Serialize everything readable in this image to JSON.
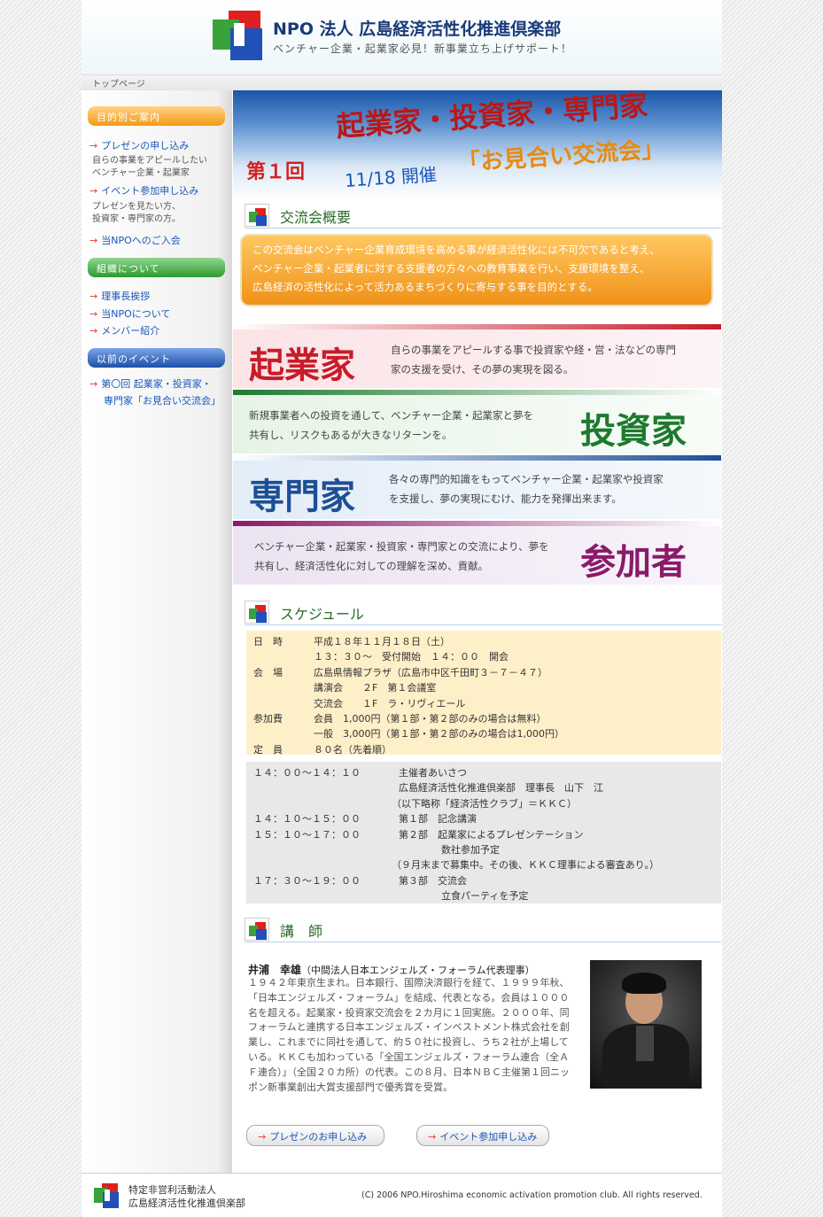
{
  "header": {
    "title": "NPO 法人 広島経済活性化推進倶楽部",
    "subtitle": "ベンチャー企業・起業家必見！新事業立ち上げサポート！"
  },
  "breadcrumb": "トップページ",
  "sidebar": {
    "section1": "目的別ご案内",
    "link_presentation": "プレゼンの申し込み",
    "desc_presentation_1": "自らの事業をアピールしたい",
    "desc_presentation_2": "ベンチャー企業・起業家",
    "link_event": "イベント参加申し込み",
    "desc_event_1": "プレゼンを見たい方、",
    "desc_event_2": "投資家・専門家の方。",
    "link_join": "当NPOへのご入会",
    "section2": "組織について",
    "link_greeting": "理事長挨拶",
    "link_about": "当NPOについて",
    "link_members": "メンバー紹介",
    "section3": "以前のイベント",
    "link_past_1": "第〇回 起業家・投資家・",
    "link_past_2": "専門家「お見合い交流会」"
  },
  "hero": {
    "number": "第１回",
    "title": "起業家・投資家・専門家",
    "date": "11/18 開催",
    "subtitle": "「お見合い交流会」"
  },
  "overview": {
    "heading": "交流会概要",
    "line1": "この交流会はベンチャー企業育成環境を高める事が経済活性化には不可欠であると考え、",
    "line2": "ベンチャー企業・起業者に対する支援者の方々への教育事業を行い、支援環境を整え、",
    "line3": "広島経済の活性化によって活力あるまちづくりに寄与する事を目的とする。"
  },
  "roles": {
    "entrepreneur": {
      "name": "起業家",
      "line1": "自らの事業をアピールする事で投資家や経・営・法などの専門",
      "line2": "家の支援を受け、その夢の実現を図る。",
      "color": "#c81c2a"
    },
    "investor": {
      "name": "投資家",
      "line1": "新規事業者への投資を通して、ベンチャー企業・起業家と夢を",
      "line2": "共有し、リスクもあるが大きなリターンを。",
      "color": "#1d7a2e"
    },
    "expert": {
      "name": "専門家",
      "line1": "各々の専門的知識をもってベンチャー企業・起業家や投資家",
      "line2": "を支援し、夢の実現にむけ、能力を発揮出来ます。",
      "color": "#1d4f96"
    },
    "participant": {
      "name": "参加者",
      "line1": "ベンチャー企業・起業家・投資家・専門家との交流により、夢を",
      "line2": "共有し、経済活性化に対しての理解を深め、貢献。",
      "color": "#8a1a6a"
    }
  },
  "schedule": {
    "heading": "スケジュール",
    "date_label": "日　時",
    "date_value": "平成１８年１１月１８日（土）",
    "time_value": "１３：３０～　受付開始　１４：００　開会",
    "venue_label": "会　場",
    "venue_value": "広島県情報プラザ（広島市中区千田町３－７－４７）",
    "venue_hall": "講演会　　２F　第１会議室",
    "venue_party": "交流会　　１F　ラ・リヴィエール",
    "fee_label": "参加費",
    "fee_member": "会員　1,000円（第１部・第２部のみの場合は無料）",
    "fee_general": "一般　3,000円（第１部・第２部のみの場合は1,000円）",
    "capacity_label": "定　員",
    "capacity_value": "８０名（先着順）",
    "p1_time": "１４：００～１４：１０",
    "p1_title": "主催者あいさつ",
    "p1_detail": "広島経済活性化推進倶楽部　理事長　山下　江",
    "p1_note": "（以下略称「経済活性クラブ」＝ＫＫＣ）",
    "p2_time": "１４：１０～１５：００",
    "p2_title": "第１部　記念講演",
    "p3_time": "１５：１０～１７：００",
    "p3_title": "第２部　起業家によるプレゼンテーション",
    "p3_detail": "数社参加予定",
    "p3_note": "（９月末まで募集中。その後、ＫＫＣ理事による審査あり。）",
    "p4_time": "１７：３０～１９：００",
    "p4_title": "第３部　交流会",
    "p4_detail": "立食パーティを予定"
  },
  "speaker": {
    "heading": "講　師",
    "name": "井浦　幸雄",
    "affiliation": "（中間法人日本エンジェルズ・フォーラム代表理事）",
    "bio": "１９４２年東京生まれ。日本銀行、国際決済銀行を経て、１９９９年秋、「日本エンジェルズ・フォーラム」を結成、代表となる。会員は１０００名を超える。起業家・投資家交流会を２カ月に１回実施。２０００年、同フォーラムと連携する日本エンジェルズ・インベストメント株式会社を創業し、これまでに同社を通して、約５０社に投資し、うち２社が上場している。ＫＫＣも加わっている「全国エンジェルズ・フォーラム連合（全ＡＦ連合）」（全国２０カ所）の代表。この８月、日本ＮＢＣ主催第１回ニッポン新事業創出大賞支援部門で優秀賞を受賞。"
  },
  "buttons": {
    "presentation": "プレゼンのお申し込み",
    "event": "イベント参加申し込み"
  },
  "footer": {
    "org_line1": "特定非営利活動法人",
    "org_line2": "広島経済活性化推進倶楽部",
    "copyright": "(C) 2006  NPO.Hiroshima economic activation promotion club. All rights reserved."
  }
}
